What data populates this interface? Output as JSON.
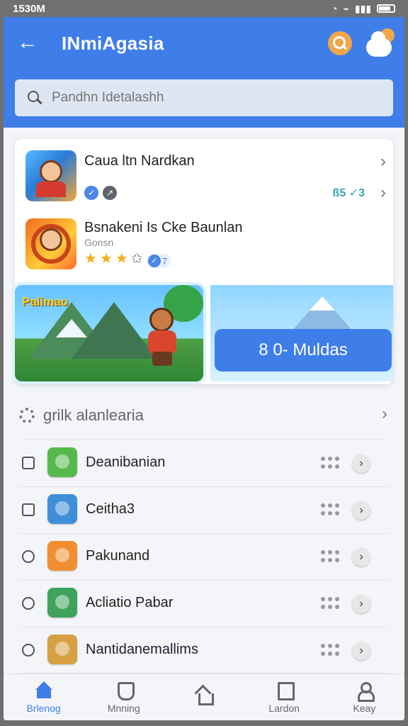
{
  "status": {
    "time": "1530M",
    "signal_glyph": "◔",
    "wifi_glyph": "⌁",
    "cell_glyph": "▮▮▮"
  },
  "app": {
    "title": "INmiAgasia",
    "back_icon": "back-arrow-icon",
    "search_icon": "search-icon",
    "settings_icon": "weather-settings-icon",
    "accent": "#3f7ee8",
    "secondary": "#f0a64a"
  },
  "search": {
    "placeholder": "Pandhn Idetalashh"
  },
  "featured": {
    "games": [
      {
        "name": "Caua ltn Nardkan",
        "meta": "ß5 ✓3",
        "badge_a": "✓",
        "badge_b": "↗"
      },
      {
        "name": "Bsnakeni Is Cke Baunlan",
        "subtitle": "Gonsn",
        "rating": "3",
        "version": "7"
      }
    ],
    "promo": {
      "image_label": "Palimao",
      "button_label": "8 0- Muldas"
    }
  },
  "section": {
    "title": "grilk alanlearia"
  },
  "apps": [
    {
      "name": "Deanibanian",
      "control": "checkbox",
      "icon_color": "#57b94d"
    },
    {
      "name": "Ceitha3",
      "control": "checkbox",
      "icon_color": "#3f8fd8"
    },
    {
      "name": "Pakunand",
      "control": "radio",
      "icon_color": "#f08f32"
    },
    {
      "name": "Acliatio Pabar",
      "control": "radio",
      "icon_color": "#3fa35c"
    },
    {
      "name": "Nantidanemallims",
      "control": "radio",
      "icon_color": "#d6a043"
    }
  ],
  "nav": [
    {
      "label": "Brlenog",
      "icon": "home-icon",
      "active": true
    },
    {
      "label": "Mnning",
      "icon": "shield-icon",
      "active": false
    },
    {
      "label": "",
      "icon": "house-icon",
      "active": false
    },
    {
      "label": "Lardon",
      "icon": "document-icon",
      "active": false
    },
    {
      "label": "Keay",
      "icon": "user-icon",
      "active": false
    }
  ]
}
